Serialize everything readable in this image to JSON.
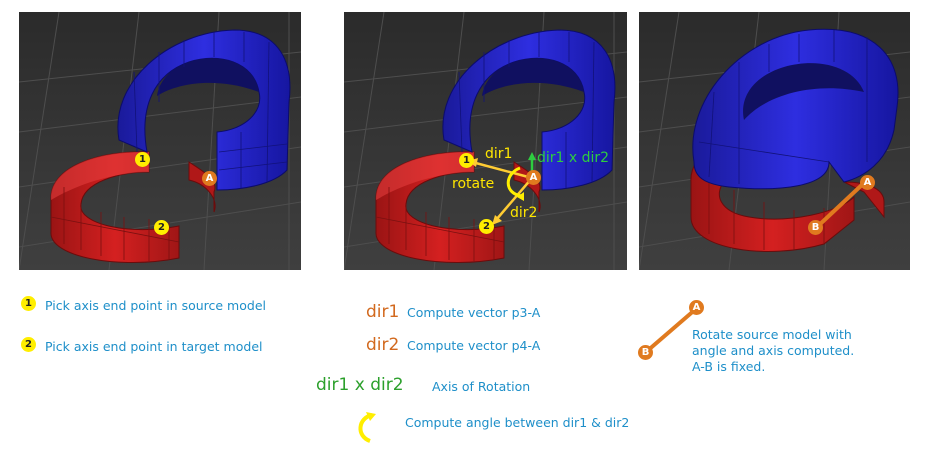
{
  "panels": [
    {
      "id": "panel-1",
      "markers": {
        "p1": "1",
        "p2": "2",
        "a": "A"
      }
    },
    {
      "id": "panel-2",
      "markers": {
        "p1": "1",
        "p2": "2",
        "a": "A"
      },
      "labels": {
        "dir1": "dir1",
        "cross": "dir1 x dir2",
        "rotate": "rotate",
        "dir2": "dir2"
      }
    },
    {
      "id": "panel-3",
      "markers": {
        "a": "A",
        "b": "B"
      }
    }
  ],
  "legend": {
    "step1": {
      "badge": "1",
      "text": "Pick axis end point in source model"
    },
    "step2": {
      "badge": "2",
      "text": "Pick axis end point in target model"
    },
    "dir1": {
      "term": "dir1",
      "text": "Compute vector p3-A"
    },
    "dir2": {
      "term": "dir2",
      "text": "Compute vector p4-A"
    },
    "axis": {
      "term": "dir1 x dir2",
      "text": "Axis of Rotation"
    },
    "angle": {
      "text": "Compute angle between dir1 & dir2"
    },
    "rotate": {
      "marker_a": "A",
      "marker_b": "B",
      "line1": "Rotate source model with",
      "line2": "angle and axis computed.",
      "line3": "A-B is fixed."
    }
  },
  "colors": {
    "viewport_bg": "#3a3a3a",
    "grid": "#505050",
    "source_model": "#2a2ad0",
    "target_model": "#c81e1e",
    "marker_yellow": "#ffee00",
    "marker_orange": "#e07a1f",
    "label_yellow": "#ffe600",
    "label_green": "#2ecc40",
    "legend_text": "#1e8fc9",
    "term_orange": "#d2691e",
    "term_green": "#2ca02c"
  }
}
